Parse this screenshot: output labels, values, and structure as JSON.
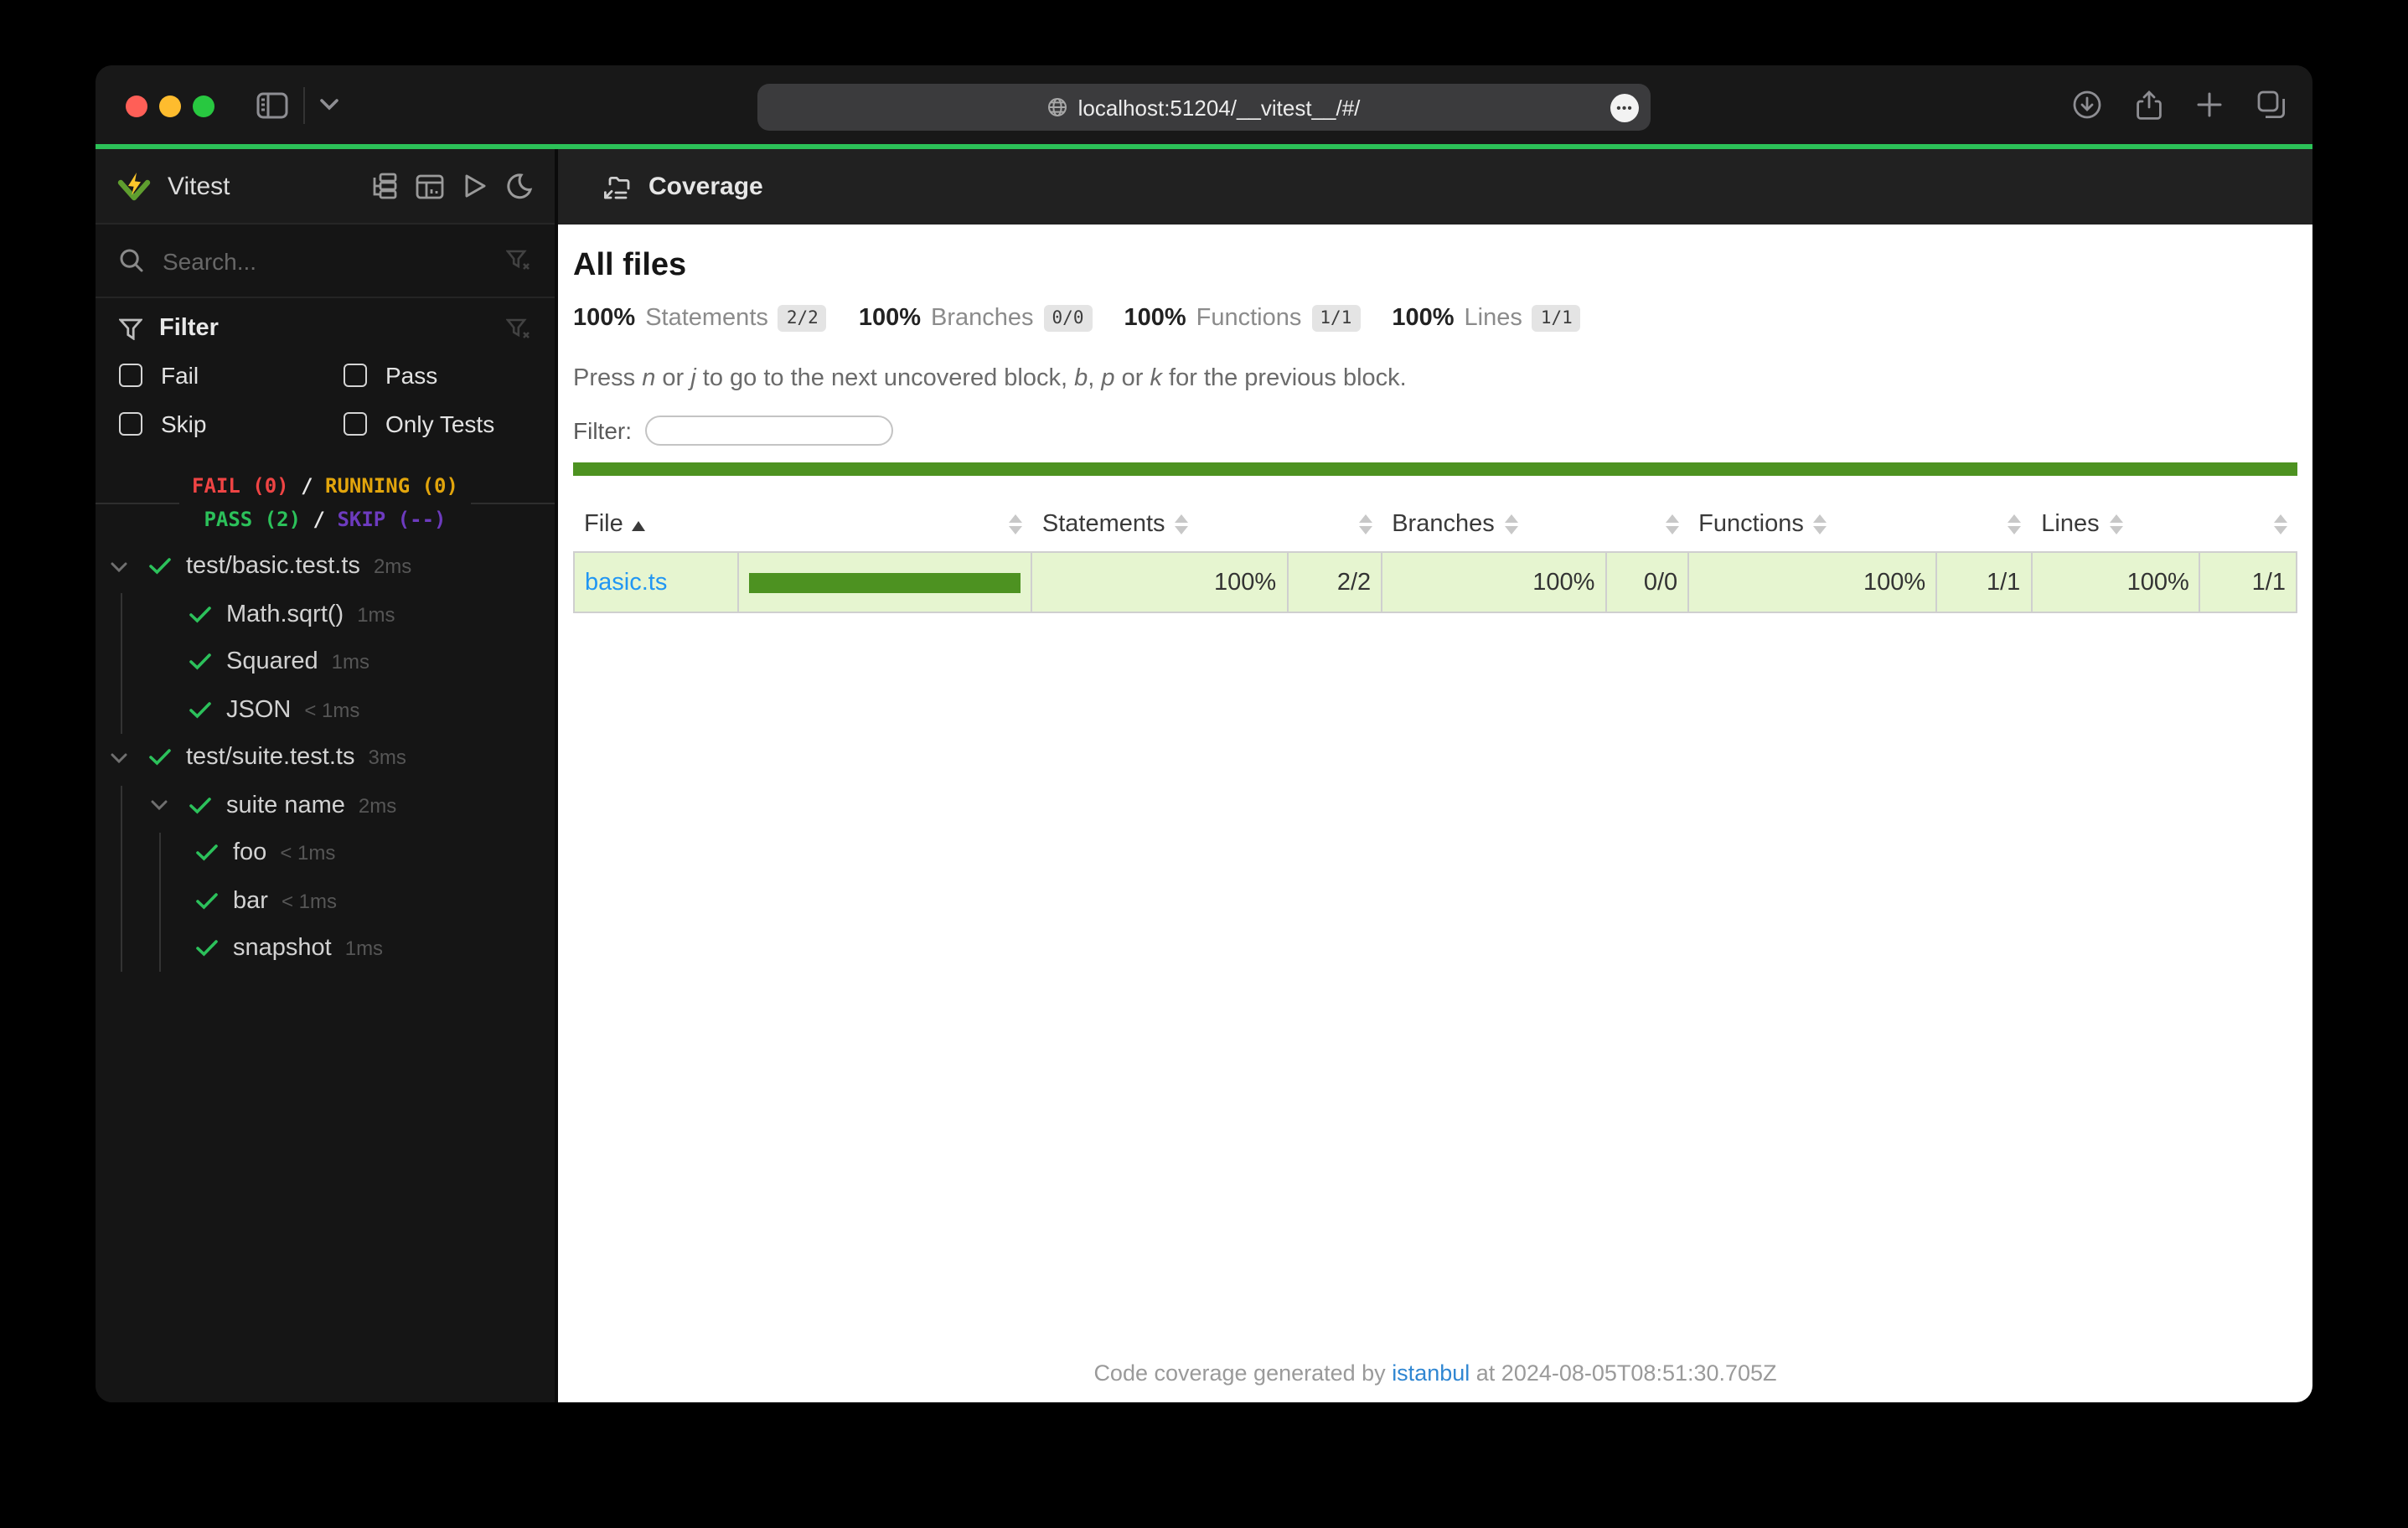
{
  "browser": {
    "url": "localhost:51204/__vitest__/#/",
    "ellipsis": "•••"
  },
  "sidebar": {
    "app_name": "Vitest",
    "search_placeholder": "Search...",
    "filter": {
      "title": "Filter",
      "options": [
        "Fail",
        "Pass",
        "Skip",
        "Only Tests"
      ]
    },
    "status": {
      "fail": "FAIL (0)",
      "running": "RUNNING (0)",
      "pass": "PASS (2)",
      "skip": "SKIP (--)",
      "sep": "/"
    },
    "tree": [
      {
        "label": "test/basic.test.ts",
        "duration": "2ms"
      },
      {
        "label": "Math.sqrt()",
        "duration": "1ms"
      },
      {
        "label": "Squared",
        "duration": "1ms"
      },
      {
        "label": "JSON",
        "duration": "< 1ms"
      },
      {
        "label": "test/suite.test.ts",
        "duration": "3ms"
      },
      {
        "label": "suite name",
        "duration": "2ms"
      },
      {
        "label": "foo",
        "duration": "< 1ms"
      },
      {
        "label": "bar",
        "duration": "< 1ms"
      },
      {
        "label": "snapshot",
        "duration": "1ms"
      }
    ]
  },
  "main": {
    "title": "Coverage",
    "heading": "All files",
    "stats": [
      {
        "pct": "100%",
        "label": "Statements",
        "frac": "2/2"
      },
      {
        "pct": "100%",
        "label": "Branches",
        "frac": "0/0"
      },
      {
        "pct": "100%",
        "label": "Functions",
        "frac": "1/1"
      },
      {
        "pct": "100%",
        "label": "Lines",
        "frac": "1/1"
      }
    ],
    "hint": {
      "s0": "Press ",
      "s1": "n",
      "s2": " or ",
      "s3": "j",
      "s4": " to go to the next uncovered block, ",
      "s5": "b",
      "s6": ", ",
      "s7": "p",
      "s8": " or ",
      "s9": "k",
      "s10": " for the previous block."
    },
    "filter_label": "Filter:",
    "table": {
      "columns": {
        "file": "File",
        "statements": "Statements",
        "branches": "Branches",
        "functions": "Functions",
        "lines": "Lines"
      },
      "rows": [
        {
          "file": "basic.ts",
          "statements_pct": "100%",
          "statements_frac": "2/2",
          "branches_pct": "100%",
          "branches_frac": "0/0",
          "functions_pct": "100%",
          "functions_frac": "1/1",
          "lines_pct": "100%",
          "lines_frac": "1/1",
          "coverage_fill_pct": 100
        }
      ]
    },
    "footer": {
      "pre": "Code coverage generated by ",
      "link": "istanbul",
      "post": " at 2024-08-05T08:51:30.705Z"
    }
  },
  "colors": {
    "accent_green": "#2cc158",
    "coverage_green": "#4d9221",
    "row_bg": "#e6f5d0",
    "fail": "#ef4444",
    "running": "#e2a50c",
    "pass": "#2cc15a",
    "skip": "#6d3bbf",
    "link": "#2196f3"
  }
}
